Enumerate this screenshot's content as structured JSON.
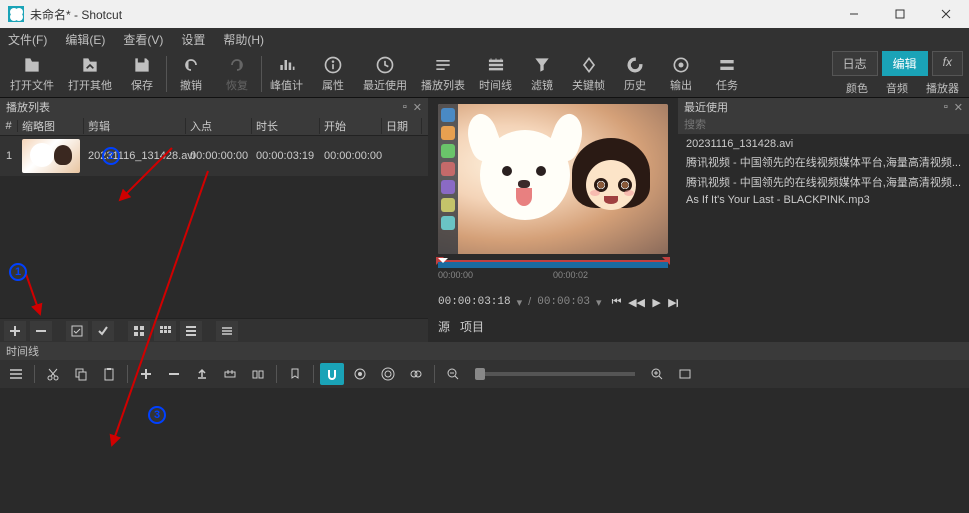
{
  "titlebar": {
    "title": "未命名* - Shotcut"
  },
  "menubar": [
    "文件(F)",
    "编辑(E)",
    "查看(V)",
    "设置",
    "帮助(H)"
  ],
  "toolbar": {
    "open_file": "打开文件",
    "open_other": "打开其他",
    "save": "保存",
    "undo": "撤销",
    "redo": "恢复",
    "peak_meter": "峰值计",
    "properties": "属性",
    "recent": "最近使用",
    "playlist": "播放列表",
    "timeline": "时间线",
    "filters": "滤镜",
    "keyframes": "关键帧",
    "history": "历史",
    "export": "输出",
    "tasks": "任务"
  },
  "tabs_right": {
    "log": "日志",
    "edit": "编辑",
    "fx": "fx"
  },
  "right_labels": {
    "color": "颜色",
    "audio": "音频",
    "player": "播放器"
  },
  "playlist_panel": {
    "title": "播放列表",
    "headers": {
      "num": "#",
      "thumb": "缩略图",
      "clip": "剪辑",
      "in": "入点",
      "duration": "时长",
      "start": "开始",
      "date": "日期"
    },
    "rows": [
      {
        "num": "1",
        "clip": "20231116_131428.avi",
        "in": "00:00:00:00",
        "duration": "00:00:03:19",
        "start": "00:00:00:00"
      }
    ]
  },
  "preview": {
    "ticks": [
      "00:00:00",
      "00:00:02"
    ],
    "current": "00:00:03:18",
    "total": "00:00:03",
    "tab_source": "源",
    "tab_project": "项目"
  },
  "recent_panel": {
    "title": "最近使用",
    "search_placeholder": "搜索",
    "items": [
      "20231116_131428.avi",
      "腾讯视频 - 中国领先的在线视频媒体平台,海量高清视频...",
      "腾讯视频 - 中国领先的在线视频媒体平台,海量高清视频...",
      "As If It's Your Last - BLACKPINK.mp3"
    ]
  },
  "timeline_panel": {
    "title": "时间线"
  }
}
